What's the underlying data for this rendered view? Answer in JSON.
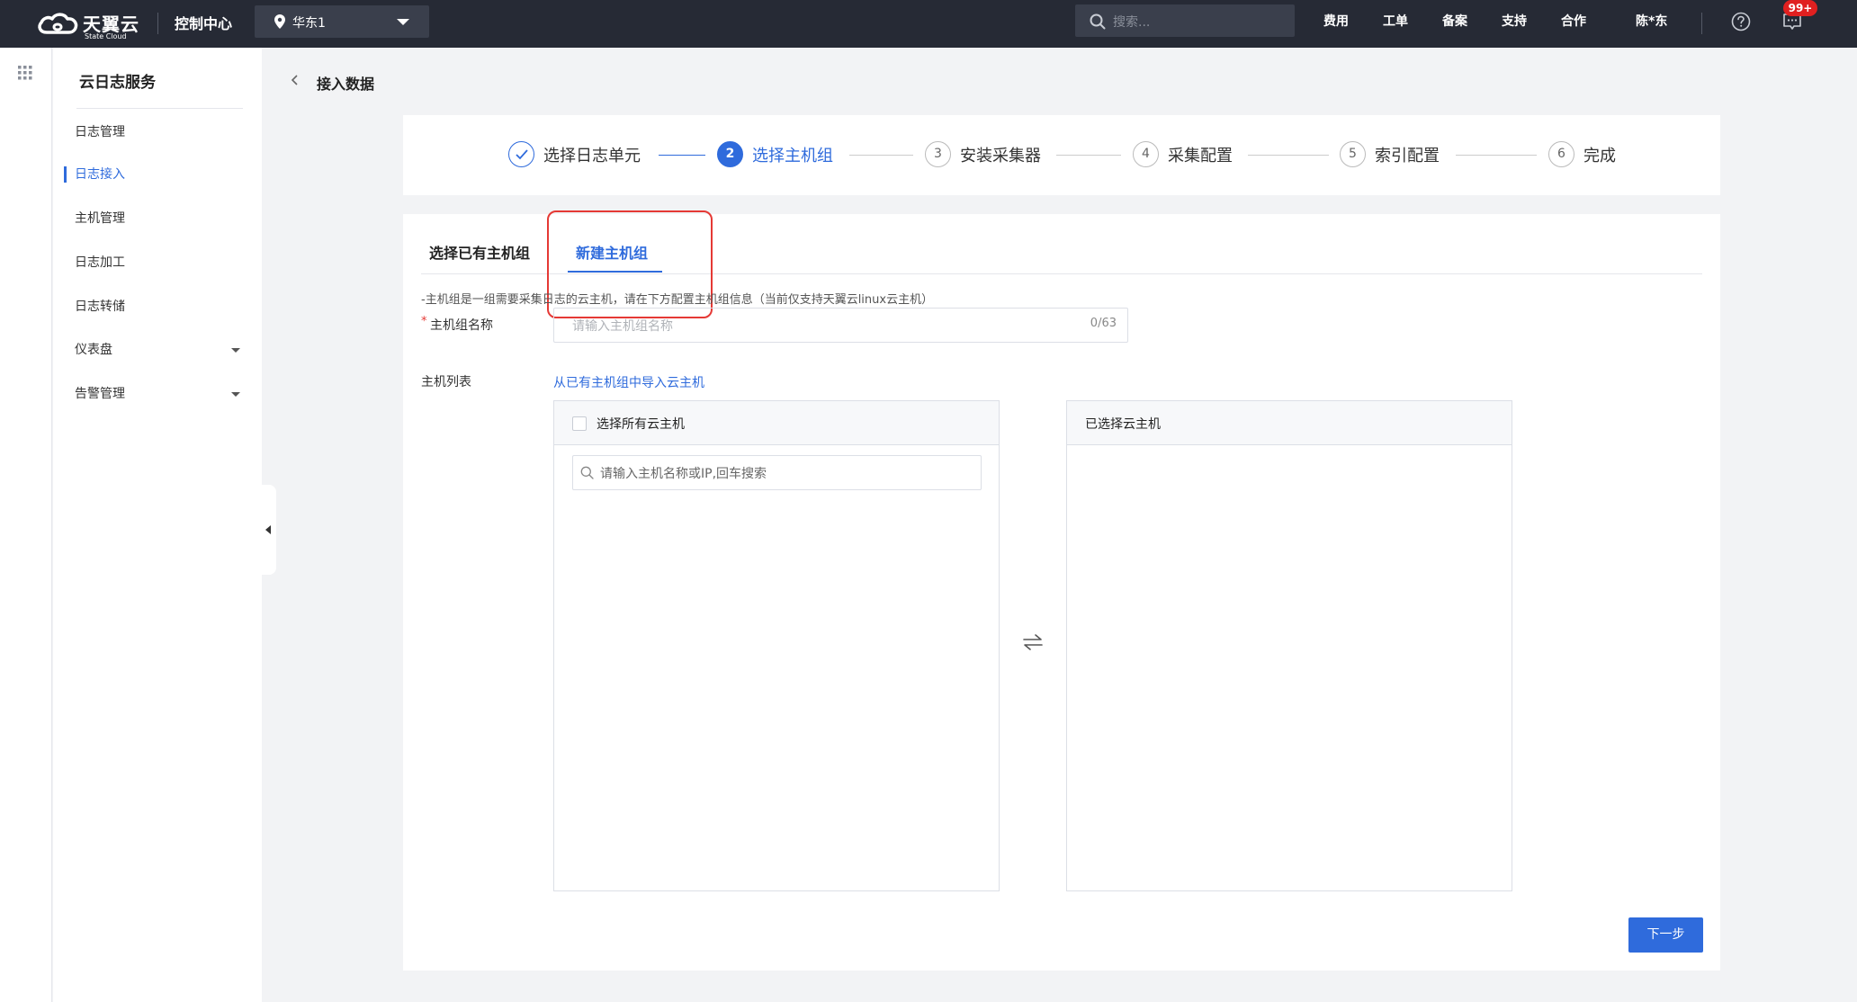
{
  "topbar": {
    "brand_name": "天翼云",
    "brand_sub": "State Cloud",
    "console_label": "控制中心",
    "region": "华东1",
    "search_placeholder": "搜索...",
    "nav": [
      "费用",
      "工单",
      "备案",
      "支持",
      "合作"
    ],
    "user": "陈*东",
    "notification_badge": "99+"
  },
  "sidebar": {
    "title": "云日志服务",
    "items": [
      {
        "label": "日志管理",
        "active": false,
        "expandable": false
      },
      {
        "label": "日志接入",
        "active": true,
        "expandable": false
      },
      {
        "label": "主机管理",
        "active": false,
        "expandable": false
      },
      {
        "label": "日志加工",
        "active": false,
        "expandable": false
      },
      {
        "label": "日志转储",
        "active": false,
        "expandable": false
      },
      {
        "label": "仪表盘",
        "active": false,
        "expandable": true
      },
      {
        "label": "告警管理",
        "active": false,
        "expandable": true
      }
    ]
  },
  "breadcrumb": {
    "title": "接入数据"
  },
  "steps": [
    {
      "number": "",
      "label": "选择日志单元",
      "status": "done"
    },
    {
      "number": "2",
      "label": "选择主机组",
      "status": "current"
    },
    {
      "number": "3",
      "label": "安装采集器",
      "status": "pending"
    },
    {
      "number": "4",
      "label": "采集配置",
      "status": "pending"
    },
    {
      "number": "5",
      "label": "索引配置",
      "status": "pending"
    },
    {
      "number": "6",
      "label": "完成",
      "status": "pending"
    }
  ],
  "tabs": [
    {
      "label": "选择已有主机组",
      "active": false
    },
    {
      "label": "新建主机组",
      "active": true
    }
  ],
  "form": {
    "hint": "-主机组是一组需要采集日志的云主机，请在下方配置主机组信息（当前仅支持天翼云linux云主机）",
    "name_label": "主机组名称",
    "name_placeholder": "请输入主机组名称",
    "name_count": "0/63",
    "host_list_label": "主机列表",
    "import_link": "从已有主机组中导入云主机",
    "left_panel": {
      "select_all_label": "选择所有云主机",
      "search_placeholder": "请输入主机名称或IP,回车搜索"
    },
    "right_panel": {
      "title": "已选择云主机"
    },
    "next_button": "下一步"
  },
  "colors": {
    "accent": "#2f6bdc",
    "topbar": "#262a35",
    "highlight": "#e53935",
    "badge": "#e02020"
  }
}
